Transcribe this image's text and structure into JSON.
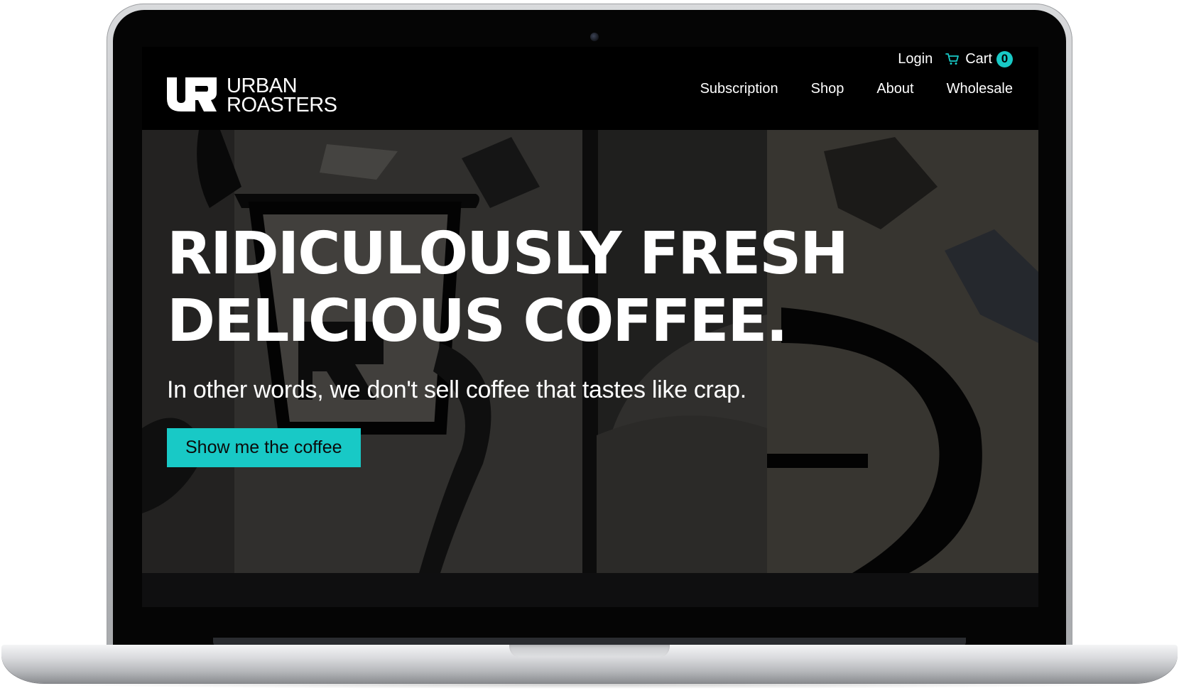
{
  "header": {
    "utility_nav": {
      "login_label": "Login",
      "cart_label": "Cart",
      "cart_count": "0"
    },
    "logo": {
      "line1": "URBAN",
      "line2": "ROASTERS"
    },
    "main_nav": [
      {
        "label": "Subscription"
      },
      {
        "label": "Shop"
      },
      {
        "label": "About"
      },
      {
        "label": "Wholesale"
      }
    ]
  },
  "hero": {
    "title_line1": "RIDICULOUSLY FRESH",
    "title_line2": "DELICIOUS COFFEE.",
    "subtitle": "In other words, we don't sell coffee that tastes like crap.",
    "cta_label": "Show me the coffee"
  },
  "colors": {
    "accent": "#18c9c6",
    "header_bg": "#000000",
    "hero_overlay": "#3b3a38",
    "text": "#ffffff"
  },
  "icons": {
    "cart": "cart-icon",
    "logo_mark": "ur-logo-icon"
  }
}
